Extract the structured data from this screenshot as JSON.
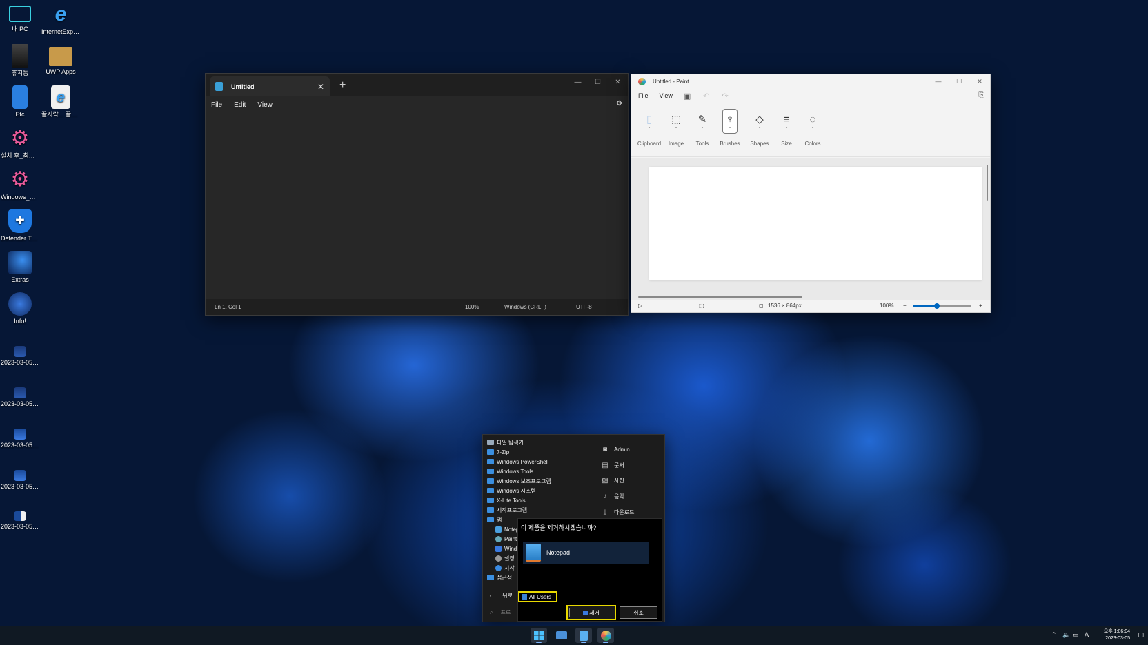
{
  "desktop": {
    "icons": [
      {
        "label": "내 PC",
        "icon": "monitor-icon"
      },
      {
        "label": "InternetExplor...",
        "icon": "internet-explorer-icon"
      },
      {
        "label": "휴지통",
        "icon": "recycle-bin-icon"
      },
      {
        "label": "UWP Apps",
        "icon": "package-icon"
      },
      {
        "label": "Etc",
        "icon": "file-icon"
      },
      {
        "label": "꿀지락... 꿀지락...",
        "icon": "internet-explorer-file-icon"
      },
      {
        "label": "설치 후_최적화.cmd",
        "icon": "gear-icon"
      },
      {
        "label": "Windows_정...",
        "icon": "gear-icon"
      },
      {
        "label": "Defender Tools.exe",
        "icon": "shield-icon"
      },
      {
        "label": "Extras",
        "icon": "wallpaper-icon"
      },
      {
        "label": "Info!",
        "icon": "globe-icon"
      },
      {
        "label": "2023-03-05_...",
        "icon": "image-icon"
      },
      {
        "label": "2023-03-05_...",
        "icon": "image-icon"
      },
      {
        "label": "2023-03-05_...",
        "icon": "image-icon"
      },
      {
        "label": "2023-03-05_...",
        "icon": "image-icon"
      },
      {
        "label": "2023-03-05_...",
        "icon": "image-icon"
      }
    ]
  },
  "notepad": {
    "tab_title": "Untitled",
    "menu": [
      "File",
      "Edit",
      "View"
    ],
    "status": {
      "position": "Ln 1, Col 1",
      "zoom": "100%",
      "line_ending": "Windows (CRLF)",
      "encoding": "UTF-8"
    }
  },
  "paint": {
    "title": "Untitled - Paint",
    "menu": [
      "File",
      "View"
    ],
    "ribbon": [
      "Clipboard",
      "Image",
      "Tools",
      "Brushes",
      "Shapes",
      "Size",
      "Colors"
    ],
    "status": {
      "canvas_size": "1536 × 864px",
      "zoom": "100%",
      "zoom_level": 0.4
    }
  },
  "start_menu": {
    "apps": [
      "파일 탐색기",
      "7-Zip",
      "Windows PowerShell",
      "Windows Tools",
      "Windows 보조프로그램",
      "Windows 시스템",
      "X-Lite Tools",
      "시작프로그램",
      "앱"
    ],
    "sub_apps": [
      "Notep",
      "Paint",
      "Windo",
      "설정",
      "시작"
    ],
    "accessibility": "접근성",
    "places": [
      "Admin",
      "문서",
      "사진",
      "음악",
      "다운로드"
    ],
    "back_label": "뒤로",
    "search_placeholder": "프로"
  },
  "dialog": {
    "question": "이 제품을 제거하시겠습니까?",
    "app_name": "Notepad",
    "all_users_label": "All Users",
    "remove_label": "제거",
    "cancel_label": "취소"
  },
  "taskbar": {
    "tray_lang": "A",
    "clock_time": "오후 1:06:04",
    "clock_date": "2023-03-05"
  }
}
